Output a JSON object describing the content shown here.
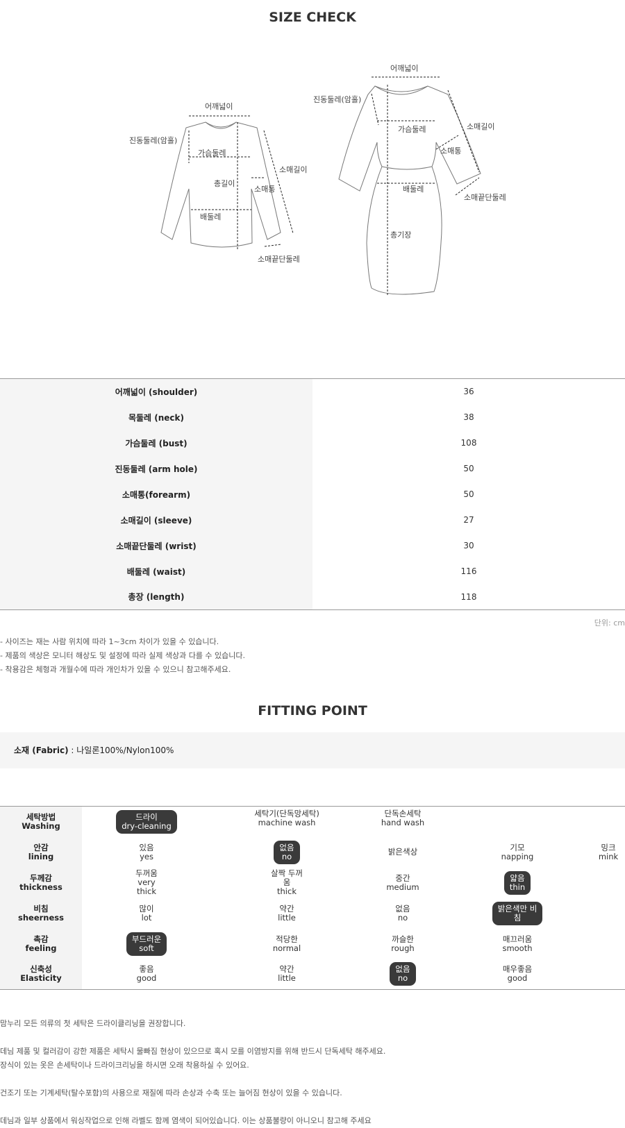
{
  "headings": {
    "size_check": "SIZE CHECK",
    "fitting_point": "FITTING POINT"
  },
  "diagram_labels": {
    "top_shoulder": "어깨넓이",
    "top_armhole": "진동둘레(암홀)",
    "top_bust": "가슴둘레",
    "top_length": "총길이",
    "top_forearm": "소매통",
    "top_sleeve": "소매길이",
    "top_waist": "배둘레",
    "top_wrist": "소매끝단둘레",
    "dress_shoulder": "어깨넓이",
    "dress_armhole": "진동둘레(암홀)",
    "dress_bust": "가슴둘레",
    "dress_sleeve": "소매길이",
    "dress_forearm": "소매통",
    "dress_waist": "배둘레",
    "dress_wrist": "소매끝단둘레",
    "dress_length": "총기장"
  },
  "size_rows": [
    {
      "label": "어깨넓이 (shoulder)",
      "value": "36"
    },
    {
      "label": "목둘레 (neck)",
      "value": "38"
    },
    {
      "label": "가슴둘레 (bust)",
      "value": "108"
    },
    {
      "label": "진동둘레 (arm hole)",
      "value": "50"
    },
    {
      "label": "소매통(forearm)",
      "value": "50"
    },
    {
      "label": "소매길이 (sleeve)",
      "value": "27"
    },
    {
      "label": "소매끝단둘레 (wrist)",
      "value": "30"
    },
    {
      "label": "배둘레 (waist)",
      "value": "116"
    },
    {
      "label": "총장 (length)",
      "value": "118"
    }
  ],
  "unit": "단위: cm",
  "notes": [
    "- 사이즈는 재는 사람 위치에 따라 1~3cm 차이가 있을 수 있습니다.",
    "- 제품의 색상은 모니터 해상도 및 설정에 따라 실제 색상과 다를 수 있습니다.",
    "- 착용감은 체형과 개월수에 따라 개인차가 있을 수 있으니 참고해주세요."
  ],
  "fabric": {
    "label": "소재 (Fabric)",
    "value": " : 나일론100%/Nylon100%"
  },
  "care": {
    "washing": {
      "ko": "세탁방법",
      "en": "Washing",
      "o1k": "드라이",
      "o1e": "dry-cleaning",
      "o2k": "세탁기(단독망세탁)",
      "o2e": "machine wash",
      "o3k": "단독손세탁",
      "o3e": "hand wash"
    },
    "lining": {
      "ko": "안감",
      "en": "lining",
      "o1k": "있음",
      "o1e": "yes",
      "o2k": "없음",
      "o2e": "no",
      "o3": "밝은색상",
      "o4k": "기모",
      "o4e": "napping",
      "o5k": "밍크",
      "o5e": "mink"
    },
    "thickness": {
      "ko": "두께감",
      "en": "thickness",
      "o1k": "두꺼움",
      "o1e1": "very",
      "o1e2": "thick",
      "o2k1": "살짝 두꺼",
      "o2k2": "움",
      "o2e": "thick",
      "o3k": "중간",
      "o3e": "medium",
      "o4k": "얇음",
      "o4e": "thin"
    },
    "sheerness": {
      "ko": "비침",
      "en": "sheerness",
      "o1k": "많이",
      "o1e": "lot",
      "o2k": "약간",
      "o2e": "little",
      "o3k": "없음",
      "o3e": "no",
      "o4k1": "밝은색만 비",
      "o4k2": "침"
    },
    "feeling": {
      "ko": "촉감",
      "en": "feeling",
      "o1k": "부드러운",
      "o1e": "soft",
      "o2k": "적당한",
      "o2e": "normal",
      "o3k": "까슬한",
      "o3e": "rough",
      "o4k": "매끄러움",
      "o4e": "smooth"
    },
    "elasticity": {
      "ko": "신축성",
      "en": "Elasticity",
      "o1k": "좋음",
      "o1e": "good",
      "o2k": "약간",
      "o2e": "little",
      "o3k": "없음",
      "o3e": "no",
      "o4k": "매우좋음",
      "o4e": "good"
    }
  },
  "care_notes": [
    "맘누리 모든 의류의 첫 세탁은 드라이클리닝을 권장합니다.",
    "데님 제품 및 컬러감이 강한 제품은 세탁시 물빠짐 현상이 있으므로 혹시 모를 이염방지를 위해 반드시 단독세탁 해주세요.",
    "장식이 있는 옷은 손세탁이나 드라이크리닝을 하시면 오래 착용하실 수 있어요.",
    "건조기 또는 기계세탁(탈수포함)의 사용으로 재질에 따라 손상과 수축 또는 늘어짐 현상이 있을 수 있습니다.",
    "데님과 일부 상품에서 워싱작업으로 인해 라벨도 함께 염색이 되어있습니다. 이는 상품불량이 아니오니 참고해 주세요"
  ]
}
